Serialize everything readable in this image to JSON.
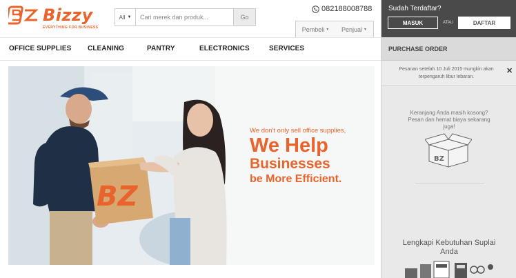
{
  "header": {
    "logo_text": "Bizzy",
    "logo_tagline": "EVERYTHING FOR BUSINESS",
    "search": {
      "category": "All",
      "placeholder": "Cari merek dan produk...",
      "go_label": "Go"
    },
    "phone": "082188008788",
    "role_tabs": [
      "Pembeli",
      "Penjual"
    ]
  },
  "nav": {
    "items": [
      "OFFICE SUPPLIES",
      "CLEANING",
      "PANTRY",
      "ELECTRONICS",
      "SERVICES"
    ]
  },
  "hero": {
    "line1": "We don't only sell office supplies,",
    "line2": "We Help",
    "line3": "Businesses",
    "line4": "be More Efficient.",
    "box_logo": "BZ"
  },
  "sidebar": {
    "register_question": "Sudah Terdaftar?",
    "login_label": "MASUK",
    "or_label": "ATAU",
    "register_label": "DAFTAR",
    "po_title": "PURCHASE ORDER",
    "notice": "Pesanan setelah 10 Juli 2015 mungkin akan terpengaruh libur lebaran.",
    "cart_empty": "Keranjang Anda masih kosong? Pesan dan hemat biaya sekarang juga!",
    "supply_title": "Lengkapi Kebutuhan Suplai Anda"
  },
  "colors": {
    "brand": "#e8642c",
    "sidebar_dark": "#4a4a4a",
    "sidebar_bg": "#e9e9e9"
  }
}
